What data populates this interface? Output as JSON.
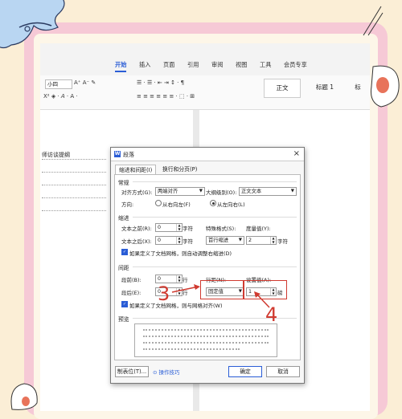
{
  "ribbon": {
    "tabs": [
      "开始",
      "插入",
      "页面",
      "引用",
      "审阅",
      "视图",
      "工具",
      "会员专享"
    ],
    "font_size": "小四",
    "styles": [
      "正文",
      "标题 1",
      "标"
    ]
  },
  "document": {
    "label": "师访谈提纲"
  },
  "dialog": {
    "title": "段落",
    "tabs": [
      "缩进和间距(I)",
      "换行和分页(P)"
    ],
    "general": {
      "heading": "常规",
      "align_label": "对齐方式(G):",
      "align_value": "两端对齐",
      "outline_label": "大纲级别(O):",
      "outline_value": "正文文本",
      "direction_label": "方向:",
      "dir_rtl": "从右向左(F)",
      "dir_ltr": "从左向右(L)"
    },
    "indent": {
      "heading": "缩进",
      "before_label": "文本之前(R):",
      "before_value": "0",
      "before_unit": "字符",
      "special_label": "特殊格式(S):",
      "special_value": "首行缩进",
      "amount_label": "度量值(Y):",
      "amount_value": "2",
      "amount_unit": "字符",
      "after_label": "文本之后(X):",
      "after_value": "0",
      "after_unit": "字符",
      "grid_check": "如果定义了文档网格，则自动调整右缩进(D)"
    },
    "spacing": {
      "heading": "间距",
      "before_label": "段前(B):",
      "before_value": "0",
      "before_unit": "行",
      "after_label": "段后(E):",
      "after_value": "0",
      "after_unit": "行",
      "line_label": "行距(N):",
      "line_value": "固定值",
      "at_label": "设置值(A):",
      "at_value": "1",
      "at_unit": "磅",
      "grid_check": "如果定义了文档网格，则与网格对齐(W)"
    },
    "preview_heading": "预览",
    "buttons": {
      "tabs": "制表位(T)...",
      "tips": "操作技巧",
      "ok": "确定",
      "cancel": "取消"
    }
  },
  "annotations": {
    "step3": "3",
    "step4": "4",
    "color": "#d03a30"
  }
}
